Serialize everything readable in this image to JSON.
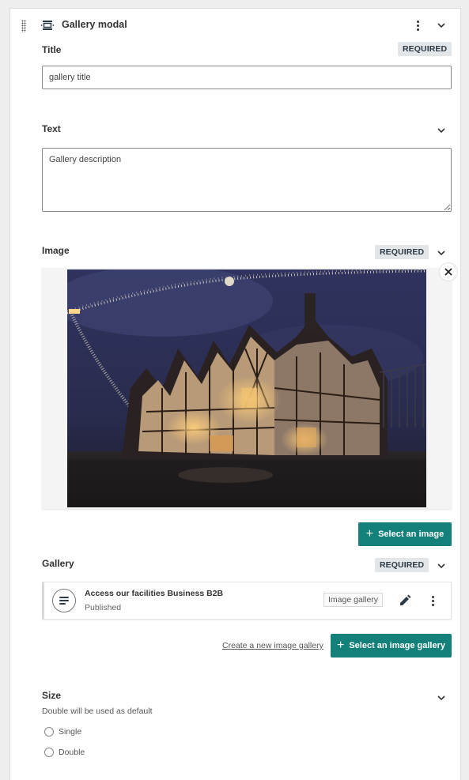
{
  "header": {
    "title": "Gallery modal",
    "icon": "gallery-modal-icon",
    "menu_icon": "more-vert-icon",
    "collapse_icon": "chevron-down-icon"
  },
  "fields": {
    "title": {
      "label": "Title",
      "badge": "REQUIRED",
      "value": "gallery title"
    },
    "text": {
      "label": "Text",
      "value": "Gallery description"
    },
    "image": {
      "label": "Image",
      "badge": "REQUIRED",
      "image_alt": "Tudor timber-framed building at night with festive lights",
      "remove_icon": "close-icon",
      "select_button": "Select an image"
    },
    "gallery": {
      "label": "Gallery",
      "badge": "REQUIRED",
      "item": {
        "icon": "notes-icon",
        "title": "Access our facilities Business B2B",
        "status": "Published",
        "type": "Image gallery",
        "edit_icon": "pencil-icon",
        "menu_icon": "more-vert-icon"
      },
      "create_link": "Create a new image gallery",
      "select_button": "Select an image gallery"
    },
    "size": {
      "label": "Size",
      "helper": "Double will be used as default",
      "options": [
        "Single",
        "Double"
      ],
      "selected": null
    }
  },
  "colors": {
    "primary": "#13807a",
    "badge_bg": "#e3e6e8"
  }
}
